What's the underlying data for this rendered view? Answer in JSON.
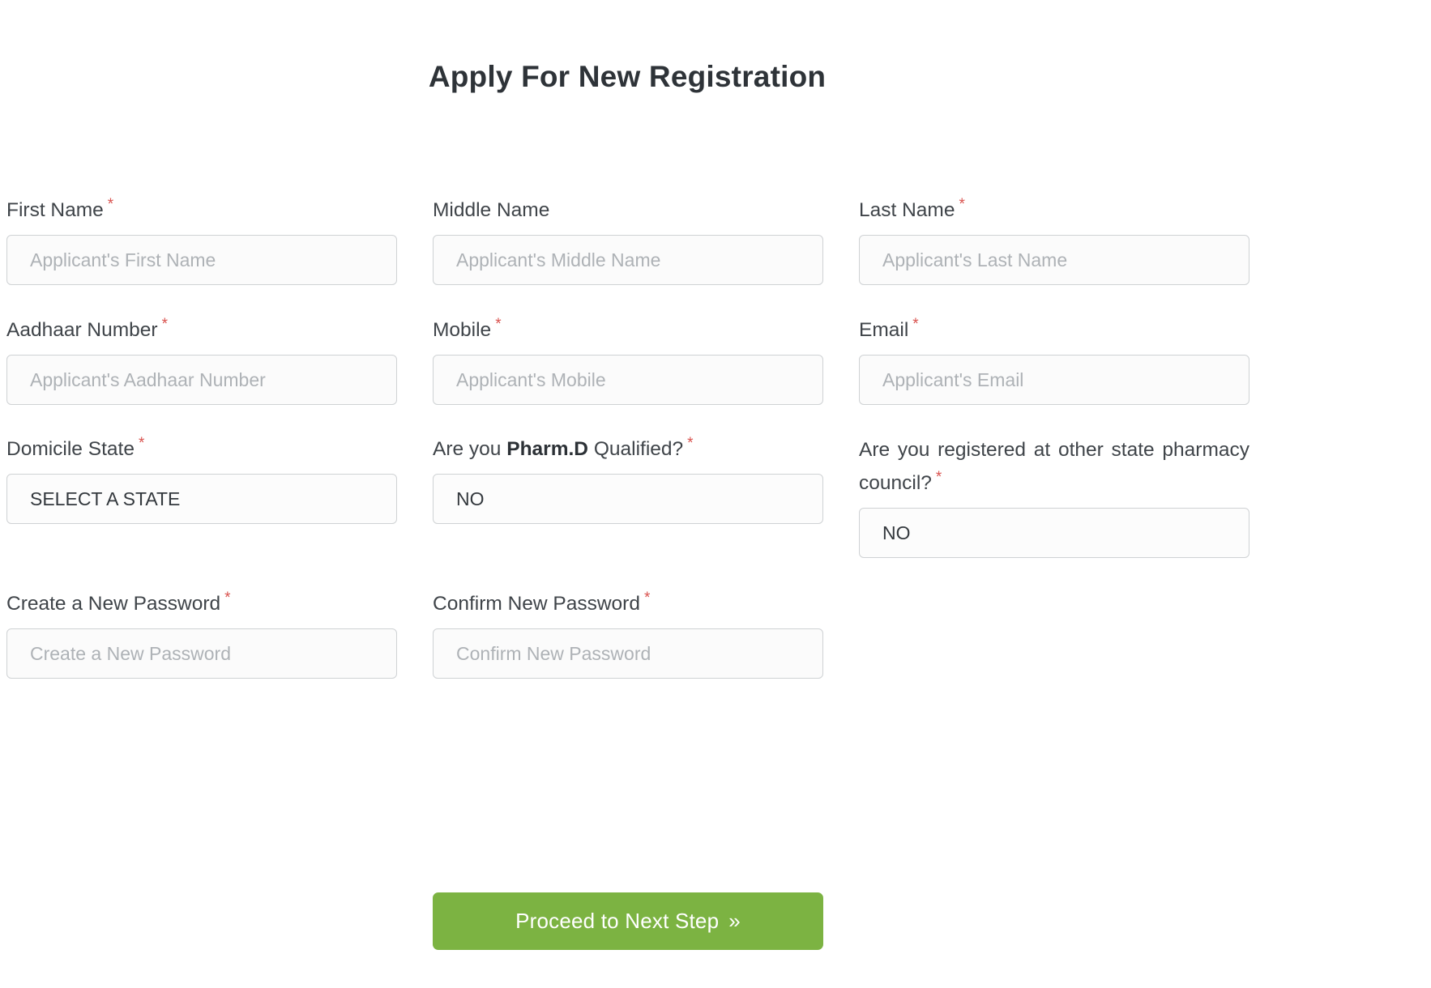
{
  "page": {
    "title": "Apply For New Registration",
    "accent_green": "#7cb342",
    "required_mark": "*",
    "required_color": "#d9534f"
  },
  "form": {
    "rows": [
      {
        "fields": [
          {
            "label": "First Name",
            "required": true,
            "type": "text",
            "placeholder": "Applicant's First Name",
            "value": ""
          },
          {
            "label": "Middle Name",
            "required": false,
            "type": "text",
            "placeholder": "Applicant's Middle Name",
            "value": ""
          },
          {
            "label": "Last Name",
            "required": true,
            "type": "text",
            "placeholder": "Applicant's Last Name",
            "value": ""
          }
        ]
      },
      {
        "fields": [
          {
            "label": "Aadhaar Number",
            "required": true,
            "type": "text",
            "placeholder": "Applicant's Aadhaar Number",
            "value": ""
          },
          {
            "label": "Mobile",
            "required": true,
            "type": "text",
            "placeholder": "Applicant's Mobile",
            "value": ""
          },
          {
            "label": "Email",
            "required": true,
            "type": "text",
            "placeholder": "Applicant's Email",
            "value": ""
          }
        ]
      },
      {
        "fields": [
          {
            "label": "Domicile State",
            "required": true,
            "type": "select",
            "selected": "SELECT A STATE"
          },
          {
            "label_prefix": "Are you ",
            "label_bold": "Pharm.D",
            "label_suffix": " Qualified?",
            "required": true,
            "type": "select",
            "selected": "NO"
          },
          {
            "label": "Are you registered at other state pharmacy council?",
            "required": true,
            "type": "select",
            "selected": "NO",
            "justified": true
          }
        ]
      },
      {
        "fields": [
          {
            "label": "Create a New Password",
            "required": true,
            "type": "password",
            "placeholder": "Create a New Password",
            "value": ""
          },
          {
            "label": "Confirm New Password",
            "required": true,
            "type": "password",
            "placeholder": "Confirm New Password",
            "value": ""
          }
        ]
      }
    ]
  },
  "submit": {
    "label": "Proceed to Next Step",
    "chevron": "»"
  }
}
